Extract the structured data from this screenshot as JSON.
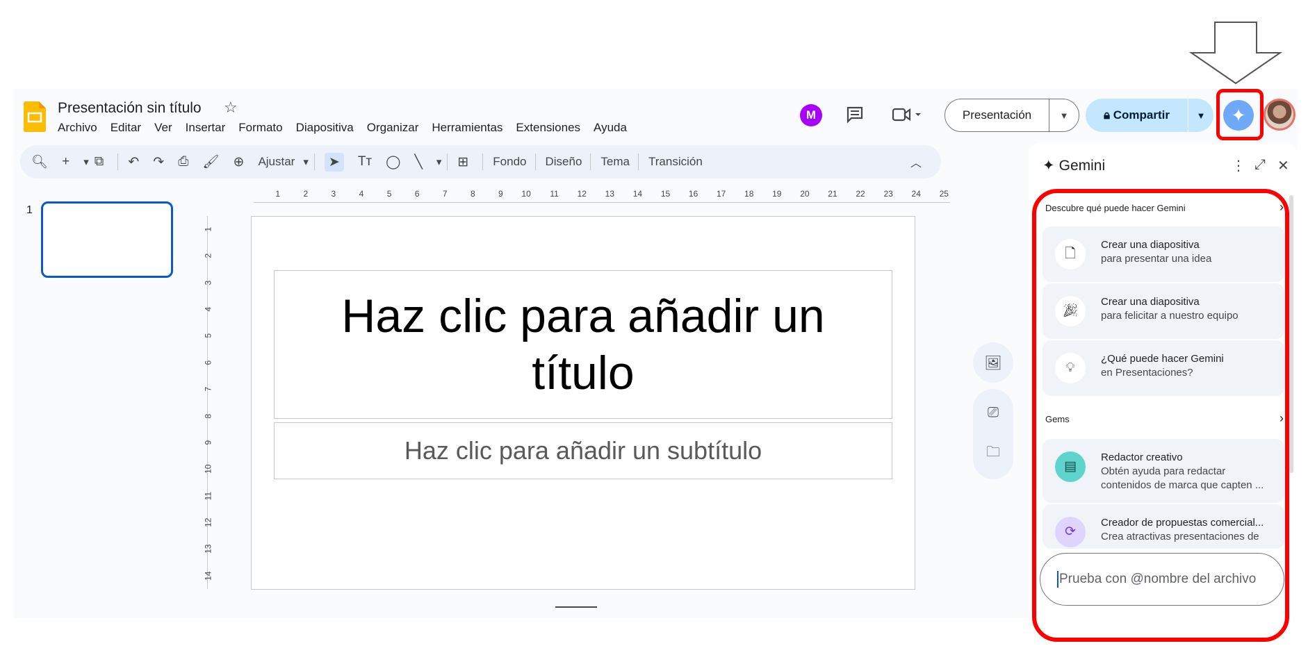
{
  "header": {
    "doc_title": "Presentación sin título",
    "menu": [
      "Archivo",
      "Editar",
      "Ver",
      "Insertar",
      "Formato",
      "Diapositiva",
      "Organizar",
      "Herramientas",
      "Extensiones",
      "Ayuda"
    ],
    "present_label": "Presentación",
    "share_label": "Compartir"
  },
  "toolbar": {
    "zoom_label": "Ajustar",
    "background_label": "Fondo",
    "layout_label": "Diseño",
    "theme_label": "Tema",
    "transition_label": "Transición"
  },
  "filmstrip": {
    "slide_number": "1"
  },
  "rulers": {
    "horizontal": [
      "1",
      "2",
      "3",
      "4",
      "5",
      "6",
      "7",
      "8",
      "9",
      "10",
      "11",
      "12",
      "13",
      "14",
      "15",
      "16",
      "17",
      "18",
      "19",
      "20",
      "21",
      "22",
      "23",
      "24",
      "25"
    ],
    "vertical": [
      "1",
      "2",
      "3",
      "4",
      "5",
      "6",
      "7",
      "8",
      "9",
      "10",
      "11",
      "12",
      "13",
      "14"
    ]
  },
  "slide": {
    "title_line1": "Haz clic para añadir un",
    "title_line2": "título",
    "subtitle": "Haz clic para añadir un subtítulo"
  },
  "gemini": {
    "title": "Gemini",
    "discover_heading": "Descubre qué puede hacer Gemini",
    "suggestions": [
      {
        "title": "Crear una diapositiva",
        "subtitle": "para presentar una idea",
        "icon": "slide-doc-icon"
      },
      {
        "title": "Crear una diapositiva",
        "subtitle": "para felicitar a nuestro equipo",
        "icon": "party-popper-icon"
      },
      {
        "title": "¿Qué puede hacer Gemini",
        "subtitle": "en Presentaciones?",
        "icon": "lightbulb-spark-icon"
      }
    ],
    "gems_heading": "Gems",
    "gems": [
      {
        "title": "Redactor creativo",
        "line1": "Obtén ayuda para redactar",
        "line2": "contenidos de marca que capten ..."
      },
      {
        "title": "Creador de propuestas comercial...",
        "line1": "Crea atractivas presentaciones de"
      }
    ],
    "prompt_placeholder": "Prueba con @nombre del archivo"
  },
  "colors": {
    "accent_blue": "#0b57d0",
    "share_bg": "#c2e7ff",
    "annotation_red": "#ff0000",
    "gemini_button": "#6fa8f7"
  }
}
